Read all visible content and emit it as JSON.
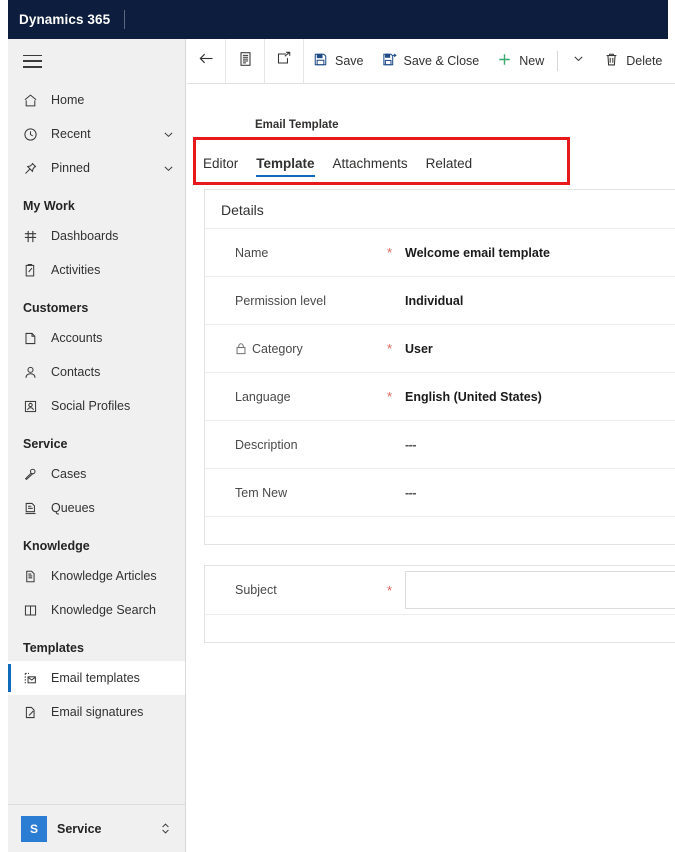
{
  "topbar": {
    "brand": "Dynamics 365"
  },
  "sidebar": {
    "menu_icon": "hamburger-icon",
    "top_items": [
      {
        "label": "Home",
        "icon": "home-icon",
        "expandable": false
      },
      {
        "label": "Recent",
        "icon": "clock-icon",
        "expandable": true
      },
      {
        "label": "Pinned",
        "icon": "pin-icon",
        "expandable": true
      }
    ],
    "groups": [
      {
        "title": "My Work",
        "items": [
          {
            "label": "Dashboards",
            "icon": "dashboard-icon"
          },
          {
            "label": "Activities",
            "icon": "activities-icon"
          }
        ]
      },
      {
        "title": "Customers",
        "items": [
          {
            "label": "Accounts",
            "icon": "account-icon"
          },
          {
            "label": "Contacts",
            "icon": "contact-icon"
          },
          {
            "label": "Social Profiles",
            "icon": "social-profile-icon"
          }
        ]
      },
      {
        "title": "Service",
        "items": [
          {
            "label": "Cases",
            "icon": "case-icon"
          },
          {
            "label": "Queues",
            "icon": "queue-icon"
          }
        ]
      },
      {
        "title": "Knowledge",
        "items": [
          {
            "label": "Knowledge Articles",
            "icon": "article-icon"
          },
          {
            "label": "Knowledge Search",
            "icon": "book-icon"
          }
        ]
      },
      {
        "title": "Templates",
        "items": [
          {
            "label": "Email templates",
            "icon": "email-template-icon",
            "selected": true
          },
          {
            "label": "Email signatures",
            "icon": "email-signature-icon",
            "selected": false
          }
        ]
      }
    ],
    "app_switcher": {
      "badge": "S",
      "name": "Service",
      "icon": "chevron-up-down-icon"
    }
  },
  "command_bar": {
    "back": "back-arrow-icon",
    "form_selector": "form-icon",
    "popout": "pop-out-icon",
    "save_label": "Save",
    "save_icon": "save-disk-icon",
    "save_close_label": "Save & Close",
    "save_close_icon": "save-close-icon",
    "new_label": "New",
    "new_icon": "plus-icon",
    "overflow_icon": "chevron-down-icon",
    "delete_label": "Delete",
    "delete_icon": "trash-icon"
  },
  "main": {
    "entity_kind": "Email Template",
    "tabs": [
      {
        "label": "Editor",
        "active": false
      },
      {
        "label": "Template",
        "active": true
      },
      {
        "label": "Attachments",
        "active": false
      },
      {
        "label": "Related",
        "active": false
      }
    ],
    "details_section": {
      "title": "Details",
      "fields": [
        {
          "label": "Name",
          "required": true,
          "locked": false,
          "value": "Welcome email template"
        },
        {
          "label": "Permission level",
          "required": false,
          "locked": false,
          "value": "Individual"
        },
        {
          "label": "Category",
          "required": true,
          "locked": true,
          "value": "User"
        },
        {
          "label": "Language",
          "required": true,
          "locked": false,
          "value": "English (United States)"
        },
        {
          "label": "Description",
          "required": false,
          "locked": false,
          "value": "---"
        },
        {
          "label": "Tem New",
          "required": false,
          "locked": false,
          "value": "---"
        }
      ]
    },
    "subject_section": {
      "label": "Subject",
      "required": true,
      "value": "",
      "placeholder": ""
    }
  },
  "annotation": {
    "type": "red-highlight-box",
    "target": "tabstrip",
    "color": "#e8191a"
  }
}
